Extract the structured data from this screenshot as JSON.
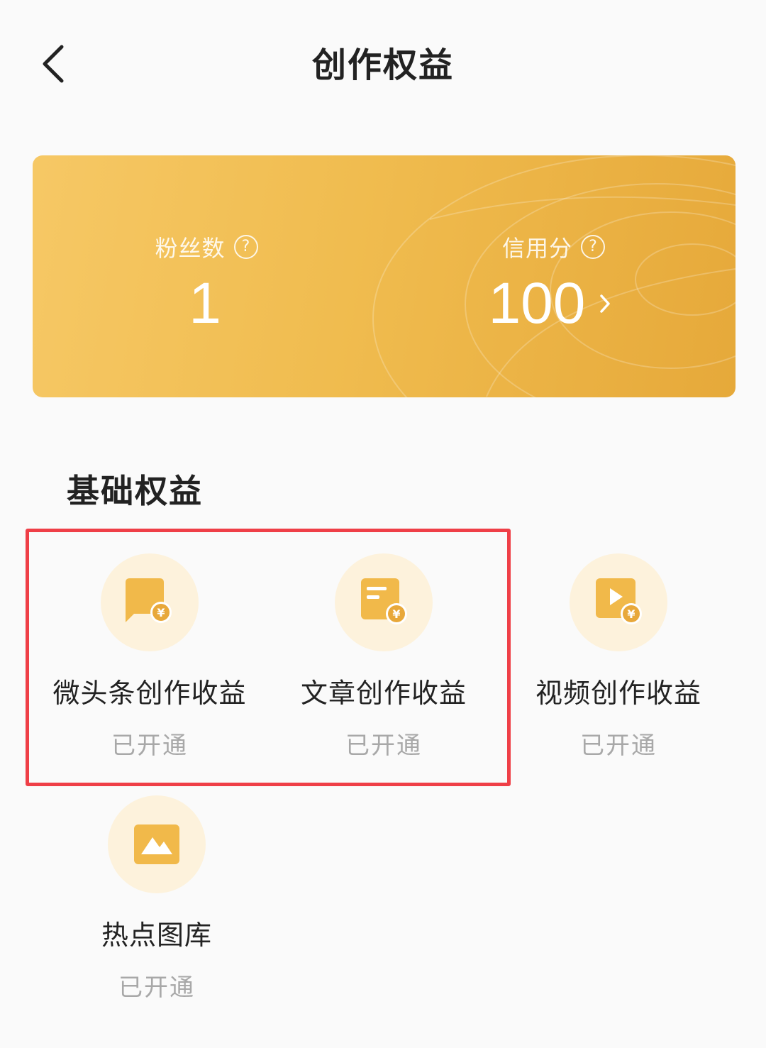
{
  "header": {
    "title": "创作权益"
  },
  "stats": {
    "fans": {
      "label": "粉丝数",
      "value": "1"
    },
    "credit": {
      "label": "信用分",
      "value": "100"
    },
    "help_glyph": "?"
  },
  "section": {
    "title": "基础权益"
  },
  "benefits": [
    {
      "name": "微头条创作收益",
      "status": "已开通",
      "icon": "chat-yuan-icon"
    },
    {
      "name": "文章创作收益",
      "status": "已开通",
      "icon": "article-yuan-icon"
    },
    {
      "name": "视频创作收益",
      "status": "已开通",
      "icon": "video-yuan-icon"
    },
    {
      "name": "热点图库",
      "status": "已开通",
      "icon": "image-gallery-icon"
    }
  ],
  "colors": {
    "accent_gold": "#f0bc4f",
    "icon_bg": "#fdf2dc",
    "highlight_red": "#ef3f47"
  }
}
